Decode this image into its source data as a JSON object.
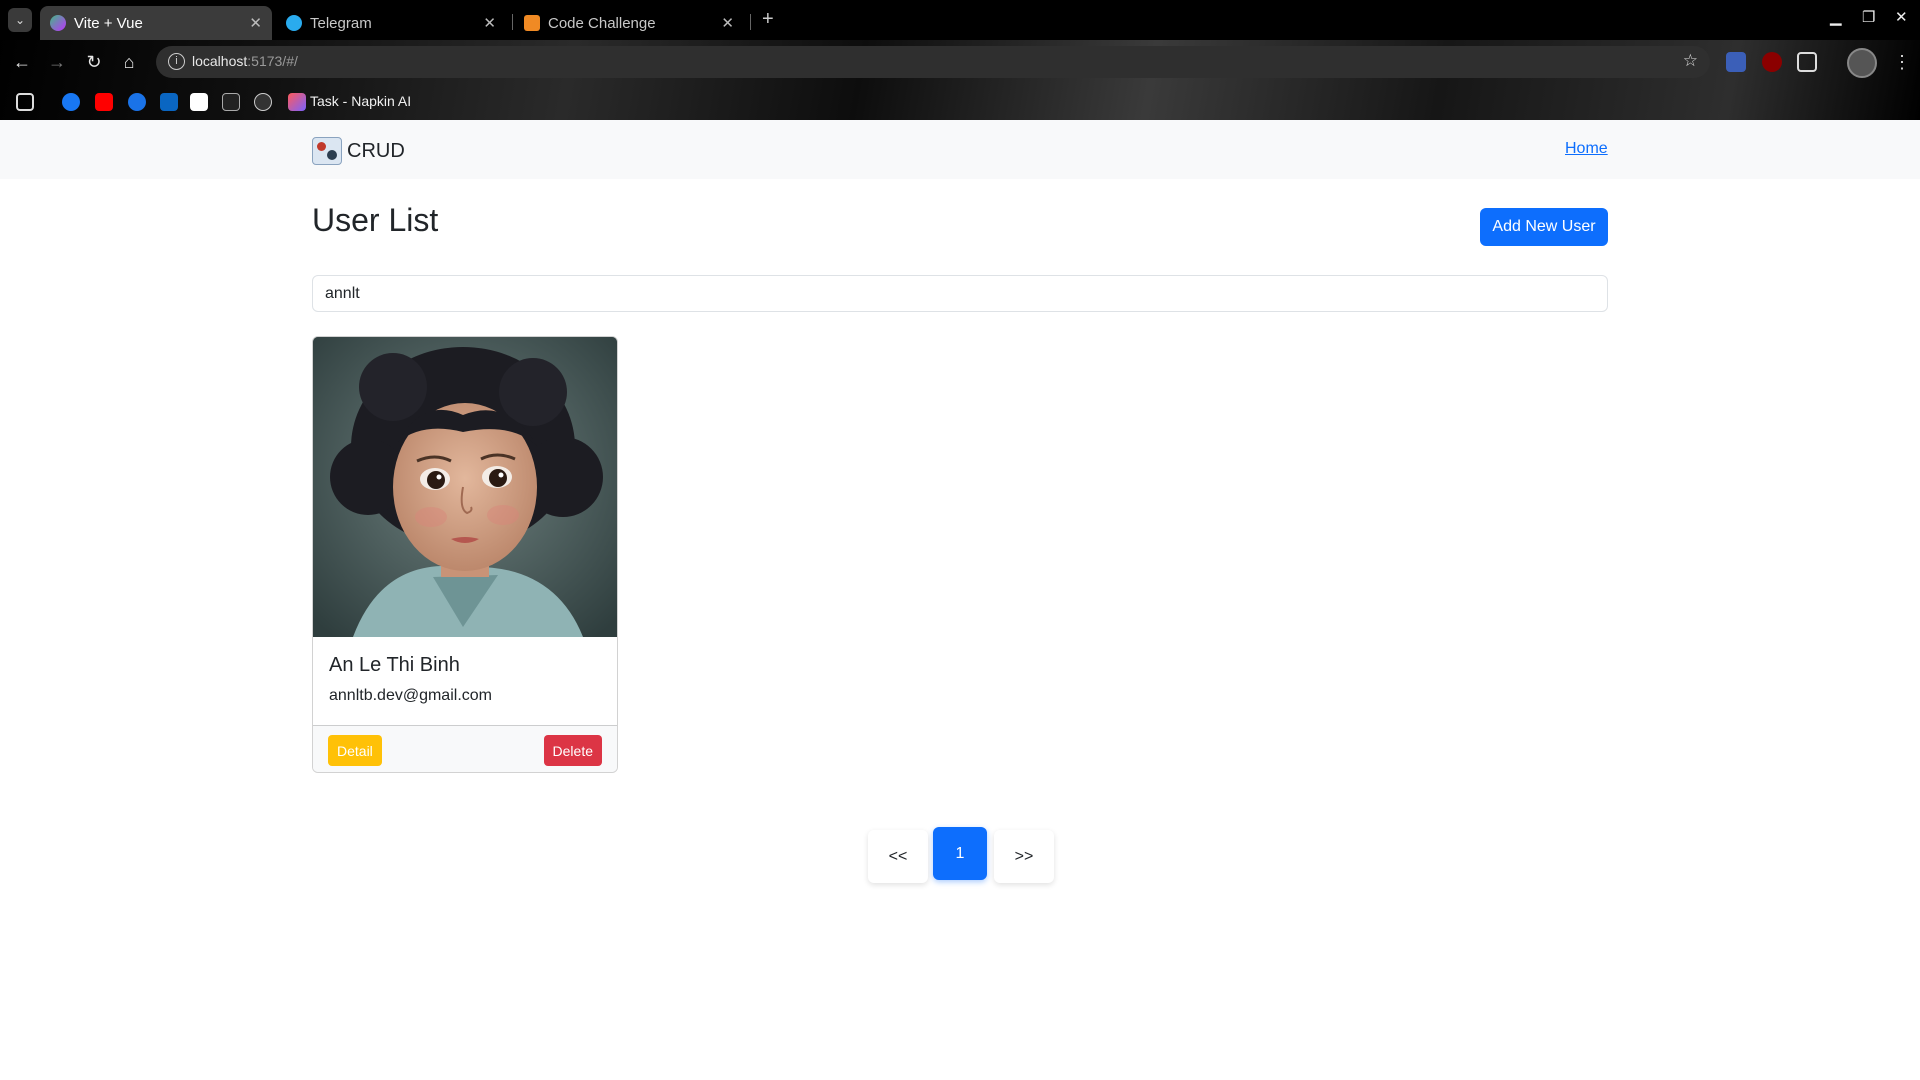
{
  "browser": {
    "tabs": [
      {
        "title": "Vite + Vue",
        "active": true
      },
      {
        "title": "Telegram",
        "active": false
      },
      {
        "title": "Code Challenge",
        "active": false
      }
    ],
    "url_host": "localhost",
    "url_rest": ":5173/#/",
    "bookmark_label": "Task - Napkin AI"
  },
  "navbar": {
    "brand": "CRUD",
    "home_link": "Home"
  },
  "main": {
    "title": "User List",
    "add_button": "Add New User",
    "search_value": "annlt"
  },
  "users": [
    {
      "name": "An Le Thi Binh",
      "email": "annltb.dev@gmail.com",
      "detail_label": "Detail",
      "delete_label": "Delete"
    }
  ],
  "pagination": {
    "prev": "<<",
    "current": "1",
    "next": ">>"
  },
  "colors": {
    "primary": "#0d6efd",
    "warning": "#ffc107",
    "danger": "#dc3545"
  }
}
